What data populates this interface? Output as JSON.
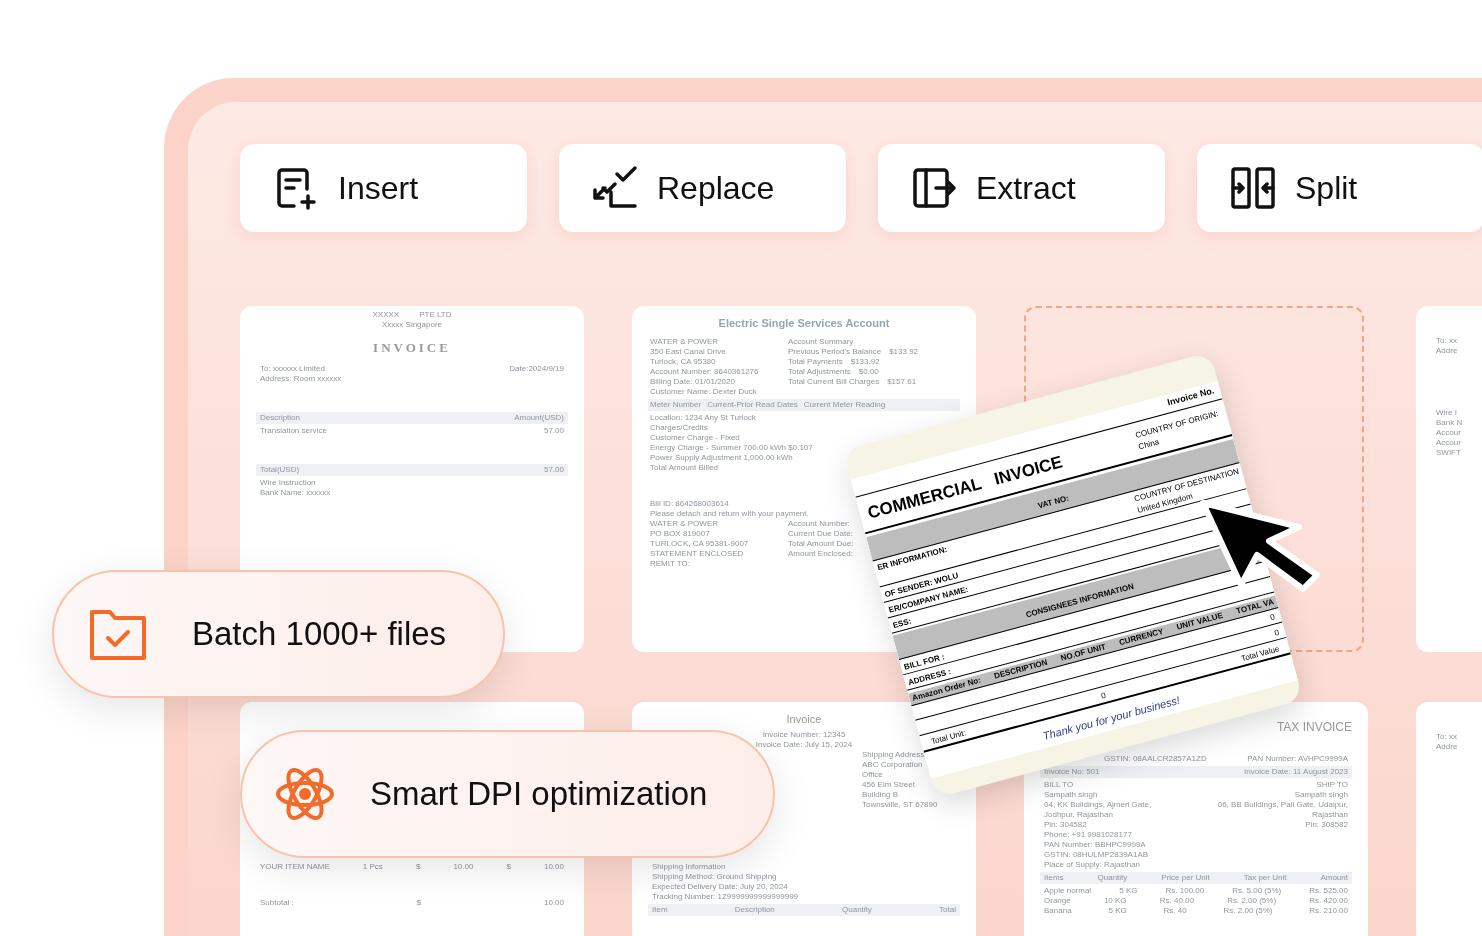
{
  "toolbar": [
    {
      "kind": "insert",
      "label": "Insert"
    },
    {
      "kind": "replace",
      "label": "Replace"
    },
    {
      "kind": "extract",
      "label": "Extract"
    },
    {
      "kind": "split",
      "label": "Split"
    }
  ],
  "documents": [
    {
      "kind": "page",
      "lines": [
        {
          "kind": "center",
          "cells": [
            "XXXXX",
            "PTE.LTD"
          ]
        },
        {
          "kind": "center",
          "cells": [
            "Xxxxx  Singapore"
          ]
        },
        {
          "kind": "title",
          "cells": [
            "INVOICE"
          ]
        },
        {
          "kind": "row",
          "cells": [
            "To: xxxxxx  Limited",
            "Date:2024/9/19"
          ]
        },
        {
          "kind": "row",
          "cells": [
            "Address: Room  xxxxxx"
          ]
        },
        {
          "kind": "gap"
        },
        {
          "kind": "head",
          "cells": [
            "Description",
            "Amount(USD)"
          ]
        },
        {
          "kind": "row",
          "cells": [
            "Translation service",
            "57.00"
          ]
        },
        {
          "kind": "gap"
        },
        {
          "kind": "head",
          "cells": [
            "Total(USD)",
            "57.00"
          ]
        },
        {
          "kind": "row",
          "cells": [
            "Wire Instruction"
          ]
        },
        {
          "kind": "row",
          "cells": [
            "Bank Name: xxxxxx"
          ]
        }
      ]
    },
    {
      "kind": "page",
      "lines": [
        {
          "kind": "heading",
          "cells": [
            "Electric Single Services Account"
          ]
        },
        {
          "kind": "cols",
          "cells": [
            "WATER & POWER",
            "Account Summary"
          ]
        },
        {
          "kind": "cols",
          "cells": [
            "350 East Canal Drive",
            "Previous Period's Balance",
            "$133.92"
          ]
        },
        {
          "kind": "cols",
          "cells": [
            "Turlock, CA 95380",
            "Total Payments",
            "$133.92"
          ]
        },
        {
          "kind": "cols",
          "cells": [
            "Account Number: 8640361276",
            "Total Adjustments",
            "$0.00"
          ]
        },
        {
          "kind": "cols",
          "cells": [
            "Billing Date: 01/01/2020",
            "Total Current Bill Charges",
            "$157.61"
          ]
        },
        {
          "kind": "cols",
          "cells": [
            "Customer Name: Dexter Duck"
          ]
        },
        {
          "kind": "head-left",
          "cells": [
            "Meter Number",
            "Current-Prior Read Dates",
            "Current Meter Reading"
          ]
        },
        {
          "kind": "cols",
          "cells": [
            "Location: 1234 Any St Turlock"
          ]
        },
        {
          "kind": "cols",
          "cells": [
            "Charges/Credits"
          ]
        },
        {
          "kind": "cols",
          "cells": [
            "Customer Charge - Fixed"
          ]
        },
        {
          "kind": "cols",
          "cells": [
            "Energy Charge - Summer 700.00 kWh $0.107"
          ]
        },
        {
          "kind": "cols",
          "cells": [
            "Power Supply Adjustment 1,000.00 kWh"
          ]
        },
        {
          "kind": "cols",
          "cells": [
            "Total Amount Billed"
          ]
        },
        {
          "kind": "gap"
        },
        {
          "kind": "cols",
          "cells": [
            "Bill ID: 864268003614"
          ]
        },
        {
          "kind": "cols",
          "cells": [
            "Please detach and return with your payment."
          ]
        },
        {
          "kind": "cols",
          "cells": [
            "WATER & POWER",
            "Account Number:"
          ]
        },
        {
          "kind": "cols",
          "cells": [
            "PO BOX 819007",
            "Current Due Date:"
          ]
        },
        {
          "kind": "cols",
          "cells": [
            "TURLOCK, CA 95381-9007",
            "Total Amount Due:"
          ]
        },
        {
          "kind": "cols",
          "cells": [
            "STATEMENT ENCLOSED",
            "Amount Enclosed:"
          ]
        },
        {
          "kind": "cols",
          "cells": [
            "REMIT TO:"
          ]
        }
      ]
    },
    {
      "kind": "slot"
    },
    {
      "kind": "page",
      "lines": [
        {
          "kind": "gap"
        },
        {
          "kind": "row",
          "cells": [
            "To: xx"
          ]
        },
        {
          "kind": "row",
          "cells": [
            "Addre"
          ]
        },
        {
          "kind": "gap"
        },
        {
          "kind": "gap"
        },
        {
          "kind": "row",
          "cells": [
            "Wire I"
          ]
        },
        {
          "kind": "row",
          "cells": [
            "Bank N"
          ]
        },
        {
          "kind": "row",
          "cells": [
            "Accour"
          ]
        },
        {
          "kind": "row",
          "cells": [
            "Accour"
          ]
        },
        {
          "kind": "row",
          "cells": [
            "SWIFT"
          ]
        }
      ]
    },
    {
      "kind": "page",
      "lines": [
        {
          "kind": "gap"
        },
        {
          "kind": "gap"
        },
        {
          "kind": "gap"
        },
        {
          "kind": "gap"
        },
        {
          "kind": "gap"
        },
        {
          "kind": "gap"
        },
        {
          "kind": "row",
          "cells": [
            "YOUR ITEM NAME",
            "1 Pcs",
            "$",
            "10.00",
            "$",
            "10.00"
          ]
        },
        {
          "kind": "gap"
        },
        {
          "kind": "row",
          "cells": [
            "Subtotal :",
            "$",
            "10.00"
          ]
        }
      ]
    },
    {
      "kind": "page",
      "lines": [
        {
          "kind": "subtitle",
          "cells": [
            "Invoice"
          ]
        },
        {
          "kind": "center",
          "cells": [
            "Invoice Number: 12345"
          ]
        },
        {
          "kind": "center",
          "cells": [
            "Invoice Date: July 15, 2024"
          ]
        },
        {
          "kind": "right",
          "cells": [
            "Shipping Address"
          ]
        },
        {
          "kind": "right",
          "cells": [
            "ABC Corporation"
          ]
        },
        {
          "kind": "right",
          "cells": [
            "Office"
          ]
        },
        {
          "kind": "right",
          "cells": [
            "456 Elm Street"
          ]
        },
        {
          "kind": "right",
          "cells": [
            "Building B"
          ]
        },
        {
          "kind": "right",
          "cells": [
            "Townsville, ST 67890"
          ]
        },
        {
          "kind": "gap"
        },
        {
          "kind": "gap"
        },
        {
          "kind": "row",
          "cells": [
            "Shipping Information"
          ]
        },
        {
          "kind": "row",
          "cells": [
            "Shipping Method: Ground Shipping"
          ]
        },
        {
          "kind": "row",
          "cells": [
            "Expected Delivery Date: July 20, 2024"
          ]
        },
        {
          "kind": "row",
          "cells": [
            "Tracking Number: 1Z9999999999999999"
          ]
        },
        {
          "kind": "head",
          "cells": [
            "Item",
            "Description",
            "Quantity",
            "Total"
          ]
        }
      ]
    },
    {
      "kind": "page",
      "lines": [
        {
          "kind": "heading-right",
          "cells": [
            "TAX INVOICE"
          ]
        },
        {
          "kind": "indent",
          "cells": [
            "GSTIN: 08AALCR2857A1ZD",
            "PAN Number: AVHPC9999A"
          ]
        },
        {
          "kind": "head",
          "cells": [
            "Invoice No: 501",
            "Invoice Date: 11 August 2023"
          ]
        },
        {
          "kind": "row",
          "cells": [
            "BILL TO",
            "SHIP TO"
          ]
        },
        {
          "kind": "row",
          "cells": [
            "Sampath singh",
            "Sampath singh"
          ]
        },
        {
          "kind": "wrap",
          "cells": [
            "04, KK Buildings, Ajmeri Gate, Jodhpur, Rajasthan",
            "06, BB Buildings, Pali Gate, Udaipur, Rajasthan"
          ]
        },
        {
          "kind": "row",
          "cells": [
            "Pin: 304582",
            "Pin: 308582"
          ]
        },
        {
          "kind": "row",
          "cells": [
            "Phone: +91 9981028177"
          ]
        },
        {
          "kind": "row",
          "cells": [
            "PAN Number: BBHPC9999A"
          ]
        },
        {
          "kind": "row",
          "cells": [
            "GSTIN: 08HULMP2839A1AB"
          ]
        },
        {
          "kind": "row",
          "cells": [
            "Place of Supply: Rajasthan"
          ]
        },
        {
          "kind": "head",
          "cells": [
            "Items",
            "Quantity",
            "Price per Unit",
            "Tax per Unit",
            "Amount"
          ]
        },
        {
          "kind": "row",
          "cells": [
            "Apple normal",
            "5 KG",
            "Rs. 100.00",
            "Rs. 5.00 (5%)",
            "Rs. 525.00"
          ]
        },
        {
          "kind": "row",
          "cells": [
            "Orange",
            "10 KG",
            "Rs. 40.00",
            "Rs. 2.00 (5%)",
            "Rs. 420.00"
          ]
        },
        {
          "kind": "row",
          "cells": [
            "Banana",
            "5 KG",
            "Rs. 40",
            "Rs. 2.00 (5%)",
            "Rs. 210.00"
          ]
        }
      ]
    },
    {
      "kind": "page",
      "lines": [
        {
          "kind": "gap"
        },
        {
          "kind": "row",
          "cells": [
            "To: xx"
          ]
        },
        {
          "kind": "row",
          "cells": [
            "Addre"
          ]
        }
      ]
    }
  ],
  "commercial_invoice": {
    "lines": [
      {
        "kind": "right",
        "cells": [
          "Invoice No."
        ]
      },
      {
        "kind": "title",
        "cells": [
          "COMMERCIAL   INVOICE",
          "COUNTRY OF ORIGIN:",
          "China"
        ]
      },
      {
        "kind": "band",
        "cells": [
          "VAT NO:"
        ]
      },
      {
        "kind": "field",
        "cells": [
          "ER INFORMATION:",
          "COUNTRY OF DESTINATION",
          "United Kingdom"
        ]
      },
      {
        "kind": "field",
        "cells": [
          "OF SENDER: WOLU"
        ]
      },
      {
        "kind": "field",
        "cells": [
          "ER/COMPANY NAME:"
        ]
      },
      {
        "kind": "field",
        "cells": [
          "ESS:"
        ]
      },
      {
        "kind": "band",
        "cells": [
          "CONSIGNEES INFORMATION"
        ]
      },
      {
        "kind": "field",
        "cells": [
          "BILL FOR :"
        ]
      },
      {
        "kind": "field",
        "cells": [
          "ADDRESS :"
        ]
      },
      {
        "kind": "head",
        "cells": [
          "Amazon Order No:",
          "DESCRIPTION",
          "NO.OF UNIT",
          "CURRENCY",
          "UNIT VALUE",
          "TOTAL VA"
        ]
      },
      {
        "kind": "total",
        "cells": [
          "0"
        ]
      },
      {
        "kind": "total",
        "cells": [
          "0"
        ]
      },
      {
        "kind": "sum",
        "cells": [
          "Total Unit:",
          "0",
          "Total Value"
        ]
      },
      {
        "kind": "thanks",
        "cells": [
          "Thank you for your business!"
        ]
      }
    ]
  },
  "badges": [
    {
      "kind": "batch",
      "label": "Batch 1000+ files"
    },
    {
      "kind": "dpi",
      "label": "Smart DPI optimization"
    }
  ]
}
